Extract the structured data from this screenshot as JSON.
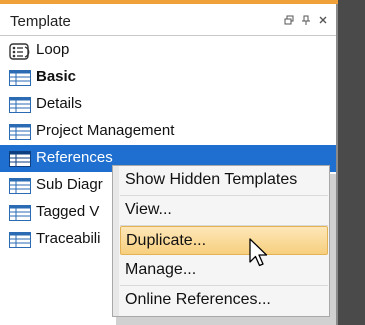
{
  "panel": {
    "title": "Template",
    "header_icons": [
      "restore-icon",
      "pin-icon",
      "close-icon"
    ]
  },
  "templates": [
    {
      "label": "Loop",
      "icon": "loop-template-icon",
      "bold": false,
      "selected": false
    },
    {
      "label": "Basic",
      "icon": "table-icon",
      "bold": true,
      "selected": false
    },
    {
      "label": "Details",
      "icon": "table-icon",
      "bold": false,
      "selected": false
    },
    {
      "label": "Project Management",
      "icon": "table-icon",
      "bold": false,
      "selected": false
    },
    {
      "label": "References",
      "icon": "table-icon",
      "bold": false,
      "selected": true
    },
    {
      "label": "Sub Diagr",
      "icon": "table-icon",
      "bold": false,
      "selected": false
    },
    {
      "label": "Tagged V",
      "icon": "table-icon",
      "bold": false,
      "selected": false
    },
    {
      "label": "Traceabili",
      "icon": "table-icon",
      "bold": false,
      "selected": false
    }
  ],
  "context_menu": {
    "items": [
      {
        "label": "Show Hidden Templates",
        "hot": false
      },
      {
        "label": "View...",
        "hot": false
      },
      {
        "label": "Duplicate...",
        "hot": true
      },
      {
        "label": "Manage...",
        "hot": false
      },
      {
        "label": "Online References...",
        "hot": false
      }
    ]
  },
  "colors": {
    "selection": "#1e6fcf",
    "hover_gradient_top": "#fde7b8",
    "hover_gradient_bottom": "#f7cf7e",
    "accent_strip": "#f0a038"
  }
}
